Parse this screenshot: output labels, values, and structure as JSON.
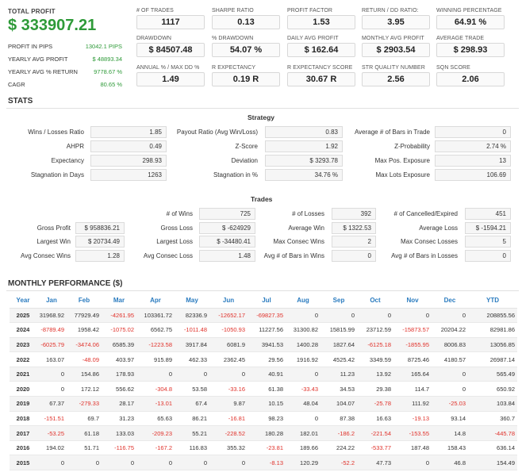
{
  "summary": {
    "total_profit_label": "TOTAL PROFIT",
    "total_profit_value": "$ 333907.21",
    "rows": [
      {
        "key": "PROFIT IN PIPS",
        "value": "13042.1 PIPS"
      },
      {
        "key": "YEARLY AVG PROFIT",
        "value": "$ 48893.34"
      },
      {
        "key": "YEARLY AVG % RETURN",
        "value": "9778.67 %"
      },
      {
        "key": "CAGR",
        "value": "80.65 %"
      }
    ]
  },
  "metrics": [
    [
      {
        "label": "# OF TRADES",
        "value": "1117"
      },
      {
        "label": "SHARPE RATIO",
        "value": "0.13"
      },
      {
        "label": "PROFIT FACTOR",
        "value": "1.53"
      },
      {
        "label": "RETURN / DD RATIO:",
        "value": "3.95"
      },
      {
        "label": "WINNING PERCENTAGE",
        "value": "64.91 %"
      }
    ],
    [
      {
        "label": "DRAWDOWN",
        "value": "$ 84507.48"
      },
      {
        "label": "% DRAWDOWN",
        "value": "54.07 %"
      },
      {
        "label": "DAILY AVG PROFIT",
        "value": "$ 162.64"
      },
      {
        "label": "MONTHLY AVG PROFIT",
        "value": "$ 2903.54"
      },
      {
        "label": "AVERAGE TRADE",
        "value": "$ 298.93"
      }
    ],
    [
      {
        "label": "ANNUAL % / MAX DD %",
        "value": "1.49"
      },
      {
        "label": "R EXPECTANCY",
        "value": "0.19 R"
      },
      {
        "label": "R EXPECTANCY SCORE",
        "value": "30.67 R"
      },
      {
        "label": "STR QUALITY NUMBER",
        "value": "2.56"
      },
      {
        "label": "SQN SCORE",
        "value": "2.06"
      }
    ]
  ],
  "stats": {
    "header": "STATS",
    "strategy": {
      "title": "Strategy",
      "rows": [
        [
          {
            "k": "Wins / Losses Ratio",
            "v": "1.85"
          },
          {
            "k": "Payout Ratio (Avg Win/Loss)",
            "v": "0.83"
          },
          {
            "k": "Average # of Bars in Trade",
            "v": "0"
          }
        ],
        [
          {
            "k": "AHPR",
            "v": "0.49"
          },
          {
            "k": "Z-Score",
            "v": "1.92"
          },
          {
            "k": "Z-Probability",
            "v": "2.74 %"
          }
        ],
        [
          {
            "k": "Expectancy",
            "v": "298.93"
          },
          {
            "k": "Deviation",
            "v": "$ 3293.78"
          },
          {
            "k": "Max Pos. Exposure",
            "v": "13"
          }
        ],
        [
          {
            "k": "Stagnation in Days",
            "v": "1263"
          },
          {
            "k": "Stagnation in %",
            "v": "34.76 %"
          },
          {
            "k": "Max Lots Exposure",
            "v": "106.69"
          }
        ]
      ]
    },
    "trades": {
      "title": "Trades",
      "rows": [
        [
          {
            "k": "",
            "v": ""
          },
          {
            "k": "# of Wins",
            "v": "725"
          },
          {
            "k": "# of Losses",
            "v": "392"
          },
          {
            "k": "# of Cancelled/Expired",
            "v": "451"
          }
        ],
        [
          {
            "k": "Gross Profit",
            "v": "$ 958836.21"
          },
          {
            "k": "Gross Loss",
            "v": "$ -624929"
          },
          {
            "k": "Average Win",
            "v": "$ 1322.53"
          },
          {
            "k": "Average Loss",
            "v": "$ -1594.21"
          }
        ],
        [
          {
            "k": "Largest Win",
            "v": "$ 20734.49"
          },
          {
            "k": "Largest Loss",
            "v": "$ -34480.41"
          },
          {
            "k": "Max Consec Wins",
            "v": "2"
          },
          {
            "k": "Max Consec Losses",
            "v": "5"
          }
        ],
        [
          {
            "k": "Avg Consec Wins",
            "v": "1.28"
          },
          {
            "k": "Avg Consec Loss",
            "v": "1.48"
          },
          {
            "k": "Avg # of Bars in Wins",
            "v": "0"
          },
          {
            "k": "Avg # of Bars in Losses",
            "v": "0"
          }
        ]
      ]
    }
  },
  "monthly": {
    "header": "MONTHLY PERFORMANCE ($)",
    "columns": [
      "Year",
      "Jan",
      "Feb",
      "Mar",
      "Apr",
      "May",
      "Jun",
      "Jul",
      "Aug",
      "Sep",
      "Oct",
      "Nov",
      "Dec",
      "YTD"
    ],
    "rows": [
      [
        "2025",
        "31968.92",
        "77929.49",
        "-4261.95",
        "103361.72",
        "82336.9",
        "-12652.17",
        "-69827.35",
        "0",
        "0",
        "0",
        "0",
        "0",
        "208855.56"
      ],
      [
        "2024",
        "-8789.49",
        "1958.42",
        "-1075.02",
        "6562.75",
        "-1011.48",
        "-1050.93",
        "11227.56",
        "31300.82",
        "15815.99",
        "23712.59",
        "-15873.57",
        "20204.22",
        "82981.86"
      ],
      [
        "2023",
        "-6025.79",
        "-3474.06",
        "6585.39",
        "-1223.58",
        "3917.84",
        "6081.9",
        "3941.53",
        "1400.28",
        "1827.64",
        "-6125.18",
        "-1855.95",
        "8006.83",
        "13056.85"
      ],
      [
        "2022",
        "163.07",
        "-48.09",
        "403.97",
        "915.89",
        "462.33",
        "2362.45",
        "29.56",
        "1916.92",
        "4525.42",
        "3349.59",
        "8725.46",
        "4180.57",
        "26987.14"
      ],
      [
        "2021",
        "0",
        "154.86",
        "178.93",
        "0",
        "0",
        "0",
        "40.91",
        "0",
        "11.23",
        "13.92",
        "165.64",
        "0",
        "565.49"
      ],
      [
        "2020",
        "0",
        "172.12",
        "556.62",
        "-304.8",
        "53.58",
        "-33.16",
        "61.38",
        "-33.43",
        "34.53",
        "29.38",
        "114.7",
        "0",
        "650.92"
      ],
      [
        "2019",
        "67.37",
        "-279.33",
        "28.17",
        "-13.01",
        "67.4",
        "9.87",
        "10.15",
        "48.04",
        "104.07",
        "-25.78",
        "111.92",
        "-25.03",
        "103.84"
      ],
      [
        "2018",
        "-151.51",
        "69.7",
        "31.23",
        "65.63",
        "86.21",
        "-16.81",
        "98.23",
        "0",
        "87.38",
        "16.63",
        "-19.13",
        "93.14",
        "360.7"
      ],
      [
        "2017",
        "-53.25",
        "61.18",
        "133.03",
        "-209.23",
        "55.21",
        "-228.52",
        "180.28",
        "182.01",
        "-186.2",
        "-221.54",
        "-153.55",
        "14.8",
        "-445.78"
      ],
      [
        "2016",
        "194.02",
        "51.71",
        "-116.75",
        "-167.2",
        "116.83",
        "355.32",
        "-23.81",
        "189.66",
        "224.22",
        "-533.77",
        "187.48",
        "158.43",
        "636.14"
      ],
      [
        "2015",
        "0",
        "0",
        "0",
        "0",
        "0",
        "0",
        "-8.13",
        "120.29",
        "-52.2",
        "47.73",
        "0",
        "46.8",
        "154.49"
      ]
    ]
  }
}
